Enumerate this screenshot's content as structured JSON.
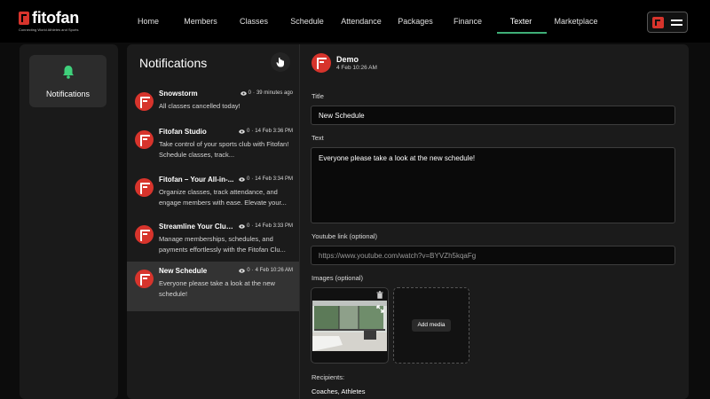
{
  "brand": {
    "name": "fitofan",
    "tagline": "Connecting World Athletes and Sports",
    "accent": "#d7342c",
    "active_underline": "#3fae77"
  },
  "nav": {
    "items": [
      "Home",
      "Members",
      "Classes",
      "Schedule",
      "Attendance",
      "Packages",
      "Finance",
      "Texter",
      "Marketplace"
    ],
    "active": "Texter"
  },
  "sidebar": {
    "tile_label": "Notifications",
    "tile_icon": "bell-icon"
  },
  "list": {
    "title": "Notifications",
    "items": [
      {
        "title": "Snowstorm",
        "views": "0",
        "time": "39 minutes ago",
        "body": "All classes cancelled today!"
      },
      {
        "title": "Fitofan Studio",
        "views": "0",
        "time": "14 Feb 3:36 PM",
        "body": "Take control of your sports club with Fitofan! Schedule classes, track..."
      },
      {
        "title": "Fitofan – Your All-in-...",
        "views": "0",
        "time": "14 Feb 3:34 PM",
        "body": "Organize classes, track attendance, and engage members with ease. Elevate your..."
      },
      {
        "title": "Streamline Your Club ...",
        "views": "0",
        "time": "14 Feb 3:33 PM",
        "body": "Manage memberships, schedules, and payments effortlessly with the Fitofan Clu..."
      },
      {
        "title": "New Schedule",
        "views": "0",
        "time": "4 Feb 10:26 AM",
        "body": "Everyone please take a look at the new schedule!"
      }
    ]
  },
  "detail": {
    "sender": "Demo",
    "date": "4 Feb 10:26 AM",
    "title_label": "Title",
    "title_value": "New Schedule",
    "text_label": "Text",
    "text_value": "Everyone please take a look at the new schedule!",
    "youtube_label": "Youtube link (optional)",
    "youtube_placeholder": "https://www.youtube.com/watch?v=BYVZh5kqaFg",
    "images_label": "Images (optional)",
    "add_media_label": "Add media",
    "recipients_label": "Recipients:",
    "recipients_value": "Coaches, Athletes"
  }
}
